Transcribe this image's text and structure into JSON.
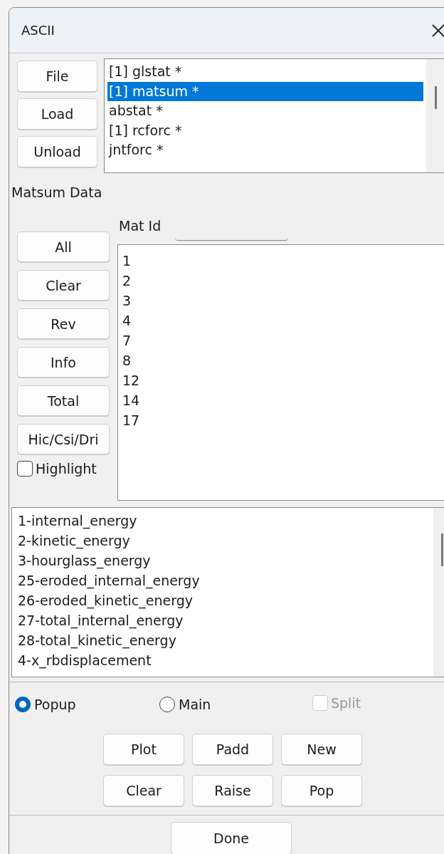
{
  "window": {
    "title": "ASCII"
  },
  "file_buttons": [
    "File",
    "Load",
    "Unload"
  ],
  "file_list": [
    {
      "label": "[1] glstat *",
      "selected": false
    },
    {
      "label": "[1] matsum *",
      "selected": true
    },
    {
      "label": "abstat *",
      "selected": false
    },
    {
      "label": "[1] rcforc *",
      "selected": false
    },
    {
      "label": "jntforc *",
      "selected": false
    }
  ],
  "section_label": "Matsum Data",
  "mat_id_label": "Mat Id",
  "selection_buttons": [
    "All",
    "Clear",
    "Rev",
    "Info",
    "Total",
    "Hic/Csi/Dri"
  ],
  "highlight": {
    "label": "Highlight",
    "checked": false
  },
  "mat_ids": [
    "1",
    "2",
    "3",
    "4",
    "7",
    "8",
    "12",
    "14",
    "17"
  ],
  "components": [
    "1-internal_energy",
    "2-kinetic_energy",
    "3-hourglass_energy",
    "25-eroded_internal_energy",
    "26-eroded_kinetic_energy",
    "27-total_internal_energy",
    "28-total_kinetic_energy",
    "4-x_rbdisplacement"
  ],
  "target": [
    {
      "label": "Popup",
      "selected": true
    },
    {
      "label": "Main",
      "selected": false
    }
  ],
  "split": {
    "label": "Split",
    "checked": false,
    "disabled": true
  },
  "plot_buttons": [
    "Plot",
    "Padd",
    "New",
    "Clear",
    "Raise",
    "Pop"
  ],
  "done_button": "Done"
}
